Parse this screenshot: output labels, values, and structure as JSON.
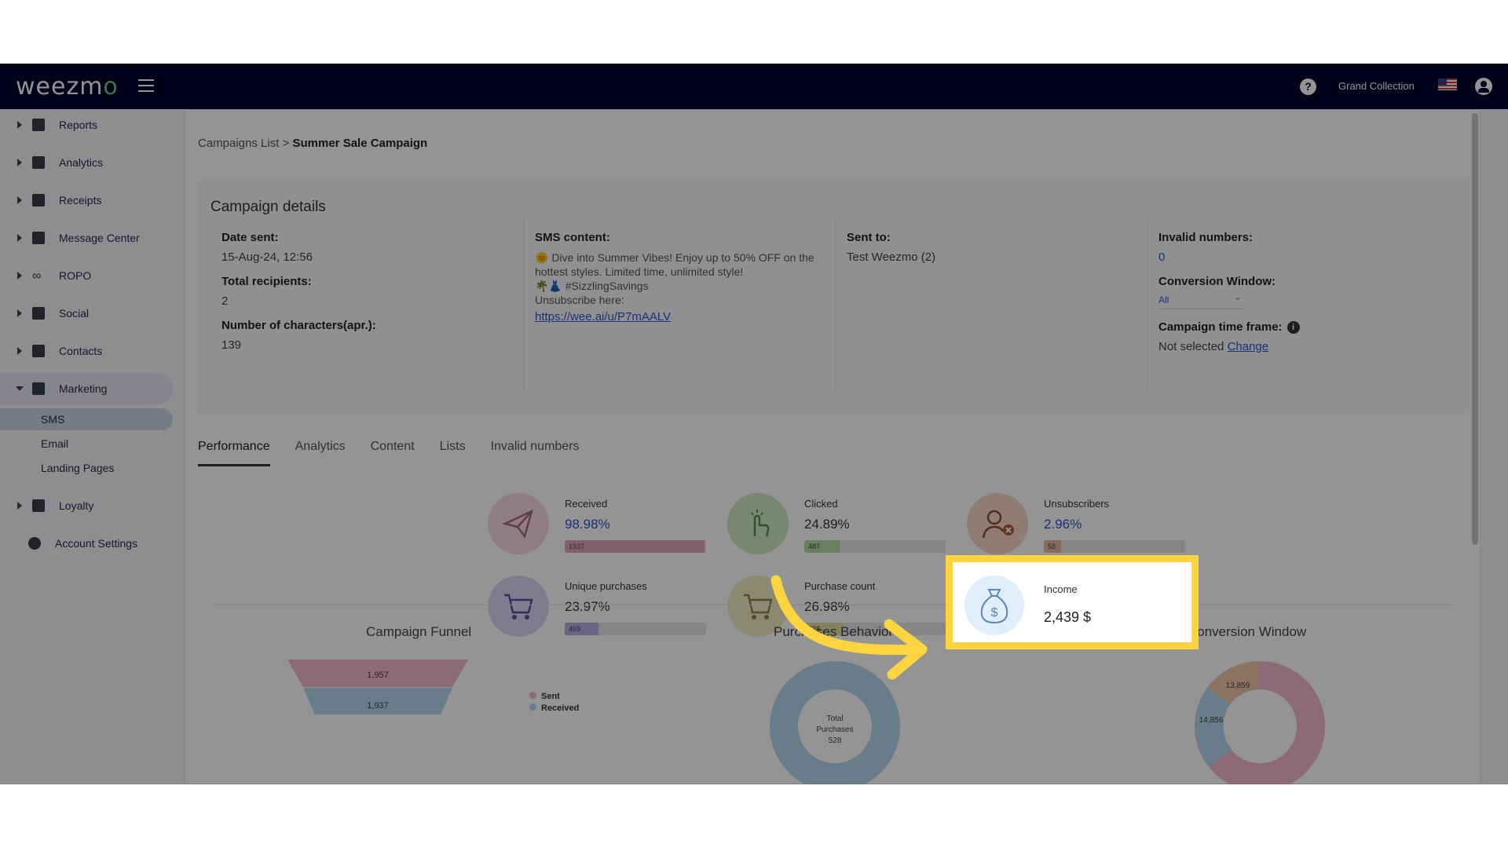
{
  "topbar": {
    "logo_text": "weezm",
    "logo_accent": "o",
    "org_name": "Grand Collection"
  },
  "sidebar": {
    "items": [
      {
        "label": "Reports",
        "icon": "dashboard-icon"
      },
      {
        "label": "Analytics",
        "icon": "chart-icon"
      },
      {
        "label": "Receipts",
        "icon": "receipt-icon"
      },
      {
        "label": "Message Center",
        "icon": "message-icon"
      },
      {
        "label": "ROPO",
        "icon": "infinity-icon"
      },
      {
        "label": "Social",
        "icon": "people-icon"
      },
      {
        "label": "Contacts",
        "icon": "contacts-icon"
      },
      {
        "label": "Marketing",
        "icon": "party-icon"
      },
      {
        "label": "Loyalty",
        "icon": "tag-icon"
      },
      {
        "label": "Account Settings",
        "icon": "gear-icon"
      }
    ],
    "marketing_sub": [
      "SMS",
      "Email",
      "Landing Pages"
    ]
  },
  "breadcrumb": {
    "parent": "Campaigns List",
    "separator": ">",
    "current": "Summer Sale Campaign"
  },
  "details": {
    "title": "Campaign details",
    "date_sent_label": "Date sent:",
    "date_sent": "15-Aug-24, 12:56",
    "total_recipients_label": "Total recipients:",
    "total_recipients": "2",
    "chars_label": "Number of characters(apr.):",
    "chars": "139",
    "sms_content_label": "SMS content:",
    "sms_line1": "🌞 Dive into Summer Vibes! Enjoy up to 50% OFF on the hottest styles. Limited time, unlimited style!",
    "sms_line2": "🌴👗 #SizzlingSavings",
    "sms_unsub": "Unsubscribe here:",
    "sms_link": "https://wee.ai/u/P7mAALV",
    "sent_to_label": "Sent to:",
    "sent_to": "Test Weezmo (2)",
    "invalid_label": "Invalid numbers:",
    "invalid_value": "0",
    "conversion_label": "Conversion Window:",
    "conversion_value": "All",
    "timeframe_label": "Campaign time frame:",
    "timeframe_value": "Not selected",
    "timeframe_change": "Change"
  },
  "tabs": [
    "Performance",
    "Analytics",
    "Content",
    "Lists",
    "Invalid numbers"
  ],
  "metrics": {
    "received": {
      "label": "Received",
      "value": "98.98%",
      "count": "1937",
      "fill": 0.99
    },
    "clicked": {
      "label": "Clicked",
      "value": "24.89%",
      "count": "487",
      "fill": 0.25
    },
    "unsubscribers": {
      "label": "Unsubscribers",
      "value": "2.96%",
      "count": "58",
      "fill": 0.03
    },
    "unique_purchases": {
      "label": "Unique purchases",
      "value": "23.97%",
      "count": "469",
      "fill": 0.24
    },
    "purchase_count": {
      "label": "Purchase count",
      "value": "26.98%",
      "count": "528",
      "fill": 0.27
    },
    "income": {
      "label": "Income",
      "value": "2,439 $"
    }
  },
  "charts": {
    "funnel_title": "Campaign Funnel",
    "funnel_values": [
      "1,957",
      "1,937"
    ],
    "funnel_legend": [
      "Sent",
      "Received"
    ],
    "behavior_title": "Purchases Behavior",
    "behavior_center": [
      "Total",
      "Purchases",
      "528"
    ],
    "conversion_title": "Conversion Window",
    "conversion_values": [
      "13,859",
      "14,856"
    ]
  },
  "colors": {
    "topbar": "#02022e",
    "highlight": "#fbd440",
    "link": "#2d55c8"
  }
}
